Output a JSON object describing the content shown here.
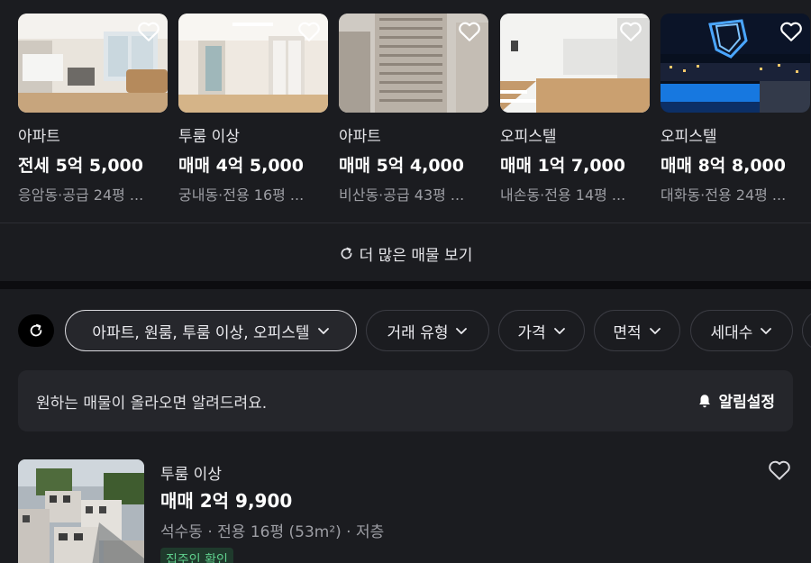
{
  "recommended": {
    "cards": [
      {
        "type": "아파트",
        "price": "전세 5억 5,000",
        "info": "응암동·공급 24평 ...",
        "image": "living-room-photo"
      },
      {
        "type": "투룸 이상",
        "price": "매매 4억 5,000",
        "info": "궁내동·전용 16평 ...",
        "image": "empty-room-photo"
      },
      {
        "type": "아파트",
        "price": "매매 5억 4,000",
        "info": "비산동·공급 43평 ...",
        "image": "apartment-tower-photo"
      },
      {
        "type": "오피스텔",
        "price": "매매 1억 7,000",
        "info": "내손동·전용 14평 ...",
        "image": "studio-photo"
      },
      {
        "type": "오피스텔",
        "price": "매매 8억 8,000",
        "info": "대화동·전용 24평 ...",
        "image": "night-city-photo"
      }
    ],
    "more_label": "더 많은 매물 보기"
  },
  "filters": {
    "chips": [
      {
        "label": "아파트, 원룸, 투룸 이상, 오피스텔",
        "active": true
      },
      {
        "label": "거래 유형",
        "active": false
      },
      {
        "label": "가격",
        "active": false
      },
      {
        "label": "면적",
        "active": false
      },
      {
        "label": "세대수",
        "active": false
      }
    ]
  },
  "alert": {
    "text": "원하는 매물이 올라오면 알려드려요.",
    "button_label": "알림설정"
  },
  "listing": {
    "type": "투룸 이상",
    "price": "매매 2억 9,900",
    "info": "석수동 · 전용 16평 (53m²) · 저층",
    "badge": "집주인 확인"
  },
  "colors": {
    "background": "#1b1c20",
    "chip_border": "#3a3b42",
    "badge_text": "#5fd08d"
  }
}
